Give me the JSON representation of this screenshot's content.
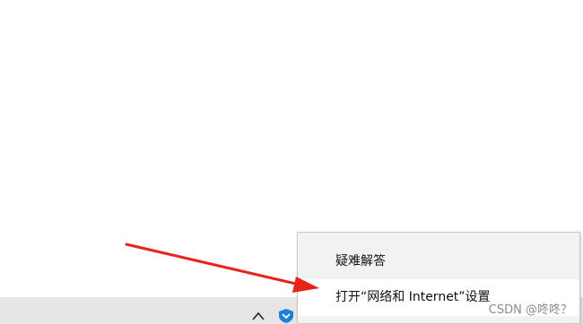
{
  "context_menu": {
    "items": [
      {
        "label": "疑难解答"
      },
      {
        "label": "打开“网络和 Internet”设置"
      }
    ]
  },
  "taskbar": {
    "tray_icons": [
      "chevron-up-icon",
      "network-shield-icon"
    ]
  },
  "watermark": {
    "text": "CSDN @咚咚？"
  },
  "colors": {
    "arrow": "#e8231c",
    "menu_bg": "#f2f2f2",
    "menu_highlight": "#ffffff",
    "taskbar_bg": "#e6e6e6",
    "shield": "#1e7fd6"
  }
}
